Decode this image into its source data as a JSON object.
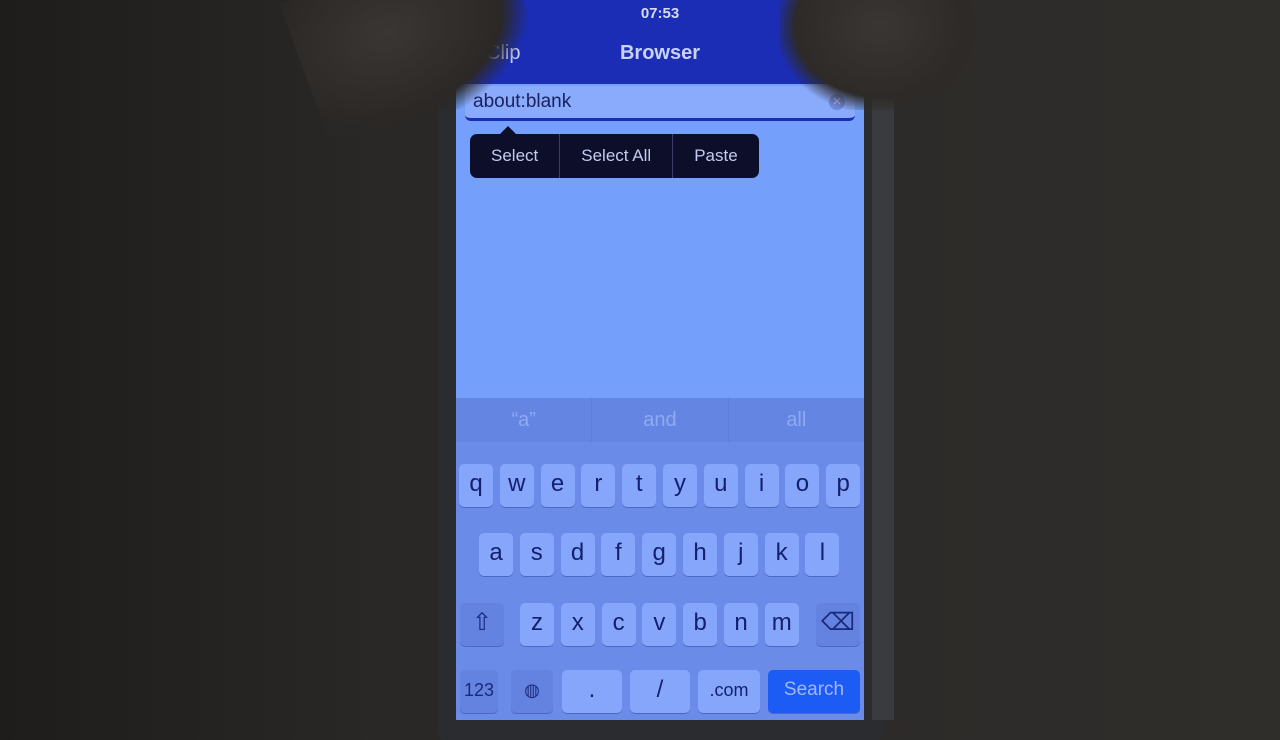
{
  "status_bar": {
    "time": "07:53"
  },
  "nav": {
    "back_label": "Clip",
    "title": "Browser"
  },
  "url_bar": {
    "value": "about:blank",
    "clear_icon": "clear-icon"
  },
  "context_menu": {
    "items": [
      "Select",
      "Select All",
      "Paste"
    ]
  },
  "keyboard": {
    "suggestions": [
      "“a”",
      "and",
      "all"
    ],
    "row1": [
      "q",
      "w",
      "e",
      "r",
      "t",
      "y",
      "u",
      "i",
      "o",
      "p"
    ],
    "row2": [
      "a",
      "s",
      "d",
      "f",
      "g",
      "h",
      "j",
      "k",
      "l"
    ],
    "row3": [
      "z",
      "x",
      "c",
      "v",
      "b",
      "n",
      "m"
    ],
    "shift_icon": "⇧",
    "delete_icon": "⌫",
    "numbers_label": "123",
    "globe_icon": "◍",
    "dot_label": ".",
    "slash_label": "/",
    "dotcom_label": ".com",
    "search_label": "Search"
  },
  "colors": {
    "nav_bar": "#1b2db4",
    "content": "#74a0fb",
    "search_key": "#1d5bf5"
  }
}
